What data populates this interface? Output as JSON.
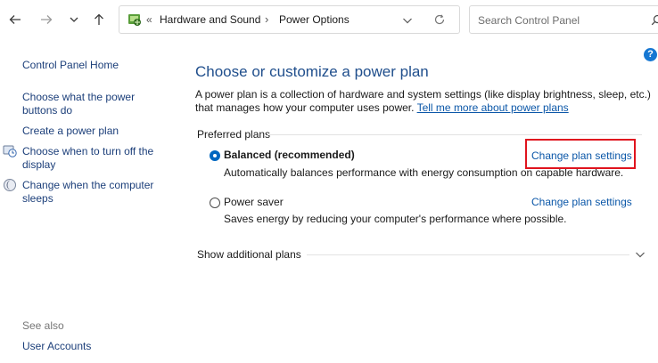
{
  "nav": {
    "back_label": "Back",
    "forward_label": "Forward",
    "recent_label": "Recent locations",
    "up_label": "Up"
  },
  "address": {
    "crumbs_prefix": "«",
    "crumb1": "Hardware and Sound",
    "separator": "›",
    "crumb2": "Power Options"
  },
  "search": {
    "placeholder": "Search Control Panel"
  },
  "help": {
    "label": "?"
  },
  "sidebar": {
    "home": "Control Panel Home",
    "items": [
      {
        "label_line1": "Choose what the power",
        "label_line2": "buttons do"
      },
      {
        "label_line1": "Create a power plan",
        "label_line2": ""
      },
      {
        "label_line1": "Choose when to turn off the",
        "label_line2": "display"
      },
      {
        "label_line1": "Change when the computer",
        "label_line2": "sleeps"
      }
    ],
    "see_also": "See also",
    "user_accounts": "User Accounts"
  },
  "main": {
    "title": "Choose or customize a power plan",
    "desc_line1": "A power plan is a collection of hardware and system settings (like display brightness, sleep, etc.)",
    "desc_line2": "that manages how your computer uses power.",
    "tell_me": "Tell me more about power plans",
    "group_label": "Preferred plans",
    "plans": [
      {
        "name": "Balanced (recommended)",
        "desc": "Automatically balances performance with energy consumption on capable hardware.",
        "link": "Change plan settings",
        "selected": true
      },
      {
        "name": "Power saver",
        "desc": "Saves energy by reducing your computer's performance where possible.",
        "link": "Change plan settings",
        "selected": false
      }
    ],
    "show_additional": "Show additional plans"
  },
  "colors": {
    "accent": "#0067c0",
    "link": "#0b57a8",
    "title": "#1f4e8c",
    "highlight": "#e0141e"
  }
}
